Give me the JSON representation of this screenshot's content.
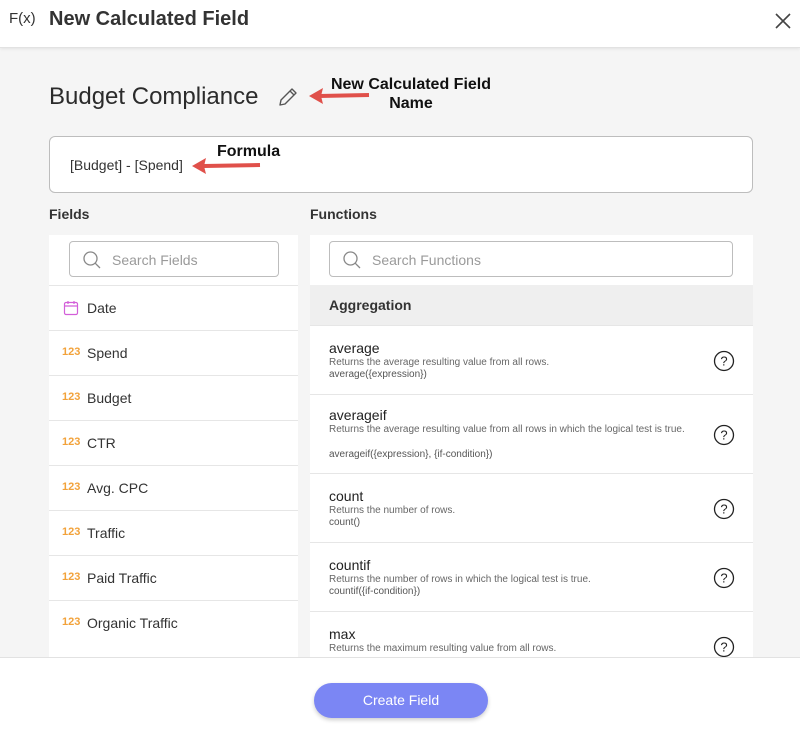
{
  "header": {
    "fx_label": "F(x)",
    "title": "New Calculated Field"
  },
  "field_name": "Budget Compliance",
  "annotations": {
    "name_line1": "New Calculated Field",
    "name_line2": "Name",
    "formula": "Formula"
  },
  "formula": "[Budget] - [Spend]",
  "fields": {
    "label": "Fields",
    "search_placeholder": "Search Fields",
    "items": [
      {
        "type": "date",
        "label": "Date"
      },
      {
        "type": "123",
        "label": "Spend"
      },
      {
        "type": "123",
        "label": "Budget"
      },
      {
        "type": "123",
        "label": "CTR"
      },
      {
        "type": "123",
        "label": "Avg. CPC"
      },
      {
        "type": "123",
        "label": "Traffic"
      },
      {
        "type": "123",
        "label": "Paid Traffic"
      },
      {
        "type": "123",
        "label": "Organic Traffic"
      }
    ]
  },
  "functions": {
    "label": "Functions",
    "search_placeholder": "Search Functions",
    "group": "Aggregation",
    "items": [
      {
        "name": "average",
        "desc": "Returns the average resulting value from all rows.",
        "sig": "average({expression})"
      },
      {
        "name": "averageif",
        "desc": "Returns the average resulting value from all rows in which the logical test is true.",
        "sig": "averageif({expression}, {if-condition})"
      },
      {
        "name": "count",
        "desc": "Returns the number of rows.",
        "sig": "count()"
      },
      {
        "name": "countif",
        "desc": "Returns the number of rows in which the logical test is true.",
        "sig": "countif({if-condition})"
      },
      {
        "name": "max",
        "desc": "Returns the maximum resulting value from all rows.",
        "sig": ""
      }
    ]
  },
  "footer": {
    "create_label": "Create Field"
  },
  "colors": {
    "accent": "#7b86f4",
    "number_icon": "#f2a23a",
    "date_icon": "#d35fd9",
    "arrow": "#e0504a"
  }
}
